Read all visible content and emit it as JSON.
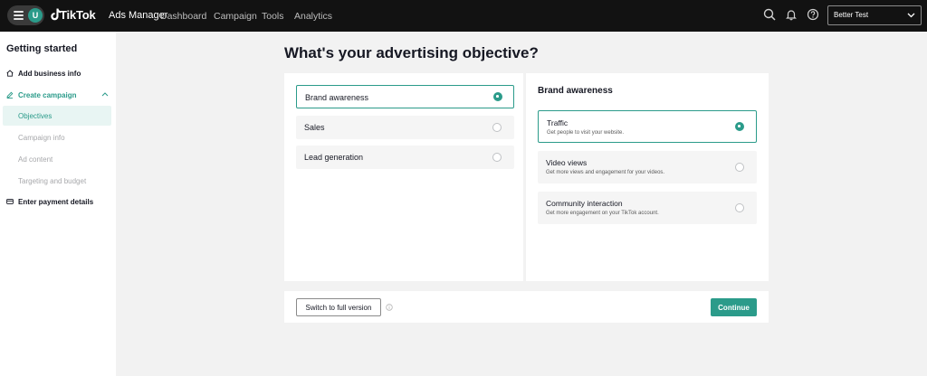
{
  "header": {
    "avatar_initial": "U",
    "brand_name": "TikTok",
    "brand_product": "Ads Manager",
    "nav": [
      "Dashboard",
      "Campaign",
      "Tools",
      "Analytics"
    ],
    "account_name": "Better Test"
  },
  "sidebar": {
    "title": "Getting started",
    "items": [
      {
        "label": "Add business info",
        "icon": "home-icon"
      },
      {
        "label": "Create campaign",
        "icon": "pencil-icon"
      },
      {
        "label": "Enter payment details",
        "icon": "card-icon"
      }
    ],
    "sub_items": [
      {
        "label": "Objectives",
        "selected": true
      },
      {
        "label": "Campaign info",
        "selected": false
      },
      {
        "label": "Ad content",
        "selected": false
      },
      {
        "label": "Targeting and budget",
        "selected": false
      }
    ]
  },
  "main": {
    "title": "What's your advertising objective?",
    "objectives": [
      {
        "label": "Brand awareness",
        "selected": true
      },
      {
        "label": "Sales",
        "selected": false
      },
      {
        "label": "Lead generation",
        "selected": false
      }
    ],
    "detail_title": "Brand awareness",
    "sub_objectives": [
      {
        "label": "Traffic",
        "desc": "Get people to visit your website.",
        "selected": true
      },
      {
        "label": "Video views",
        "desc": "Get more views and engagement for your videos.",
        "selected": false
      },
      {
        "label": "Community interaction",
        "desc": "Get more engagement on your TikTok account.",
        "selected": false
      }
    ]
  },
  "footer": {
    "switch_label": "Switch to full version",
    "continue_label": "Continue"
  },
  "colors": {
    "accent": "#2b9b8a",
    "topbar": "#121212",
    "background": "#f2f2f2"
  }
}
